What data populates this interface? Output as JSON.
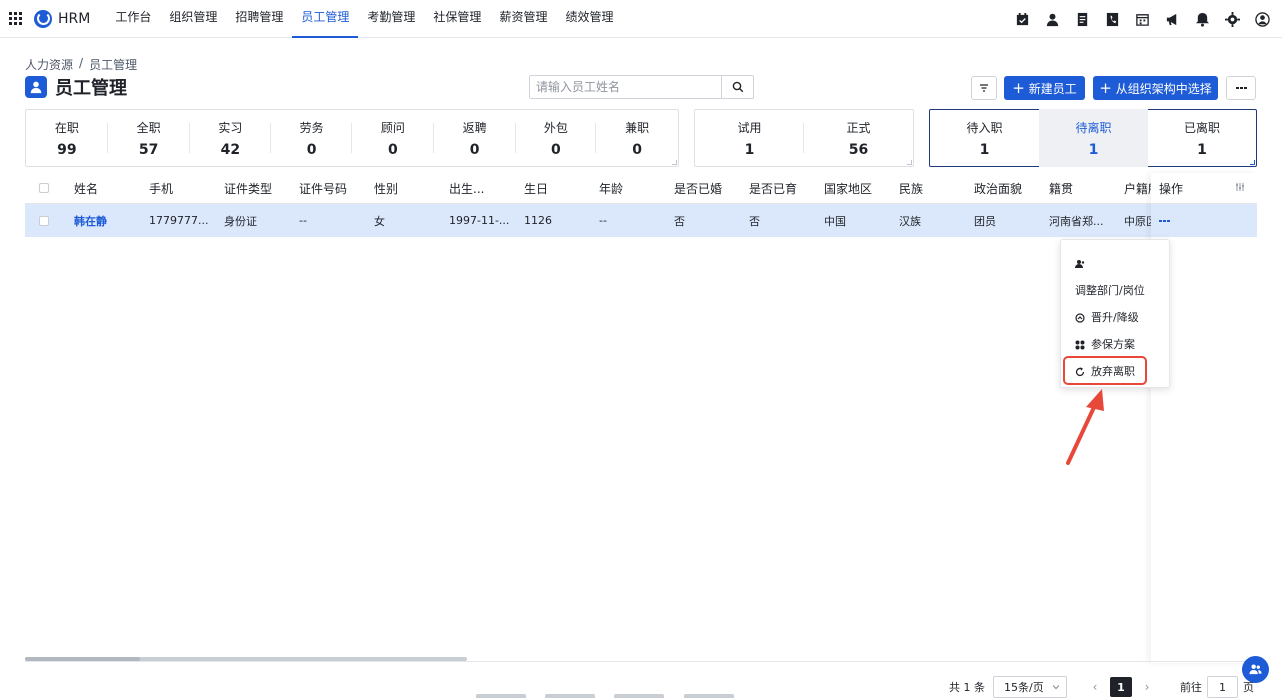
{
  "app": {
    "name": "HRM"
  },
  "nav": {
    "items": [
      "工作台",
      "组织管理",
      "招聘管理",
      "员工管理",
      "考勤管理",
      "社保管理",
      "薪资管理",
      "绩效管理"
    ],
    "active_index": 3
  },
  "breadcrumb": {
    "root": "人力资源",
    "sep": "/",
    "current": "员工管理"
  },
  "page": {
    "title": "员工管理"
  },
  "search": {
    "placeholder": "请输入员工姓名",
    "value": ""
  },
  "actions": {
    "new_employee": "新建员工",
    "from_org": "从组织架构中选择"
  },
  "stats_group1": [
    {
      "label": "在职",
      "value": "99"
    },
    {
      "label": "全职",
      "value": "57"
    },
    {
      "label": "实习",
      "value": "42"
    },
    {
      "label": "劳务",
      "value": "0"
    },
    {
      "label": "顾问",
      "value": "0"
    },
    {
      "label": "返聘",
      "value": "0"
    },
    {
      "label": "外包",
      "value": "0"
    },
    {
      "label": "兼职",
      "value": "0"
    }
  ],
  "stats_group2": [
    {
      "label": "试用",
      "value": "1"
    },
    {
      "label": "正式",
      "value": "56"
    }
  ],
  "stats_group3": [
    {
      "label": "待入职",
      "value": "1"
    },
    {
      "label": "待离职",
      "value": "1"
    },
    {
      "label": "已离职",
      "value": "1"
    }
  ],
  "table": {
    "columns": [
      "姓名",
      "手机",
      "证件类型",
      "证件号码",
      "性别",
      "出生...",
      "生日",
      "年龄",
      "是否已婚",
      "是否已育",
      "国家地区",
      "民族",
      "政治面貌",
      "籍贯",
      "户籍所"
    ],
    "ops_header": "操作",
    "rows": [
      [
        "韩在静",
        "1779777...",
        "身份证",
        "--",
        "女",
        "1997-11-...",
        "1126",
        "--",
        "否",
        "否",
        "中国",
        "汉族",
        "团员",
        "河南省郑...",
        "中原区"
      ]
    ]
  },
  "row_menu": {
    "items": [
      "调整部门/岗位",
      "晋升/降级",
      "参保方案",
      "放弃离职"
    ],
    "highlighted": "放弃离职"
  },
  "pagination": {
    "total": "共 1 条",
    "page_size": "15条/页",
    "current": "1",
    "goto_label": "前往",
    "goto_value": "1",
    "page_suffix": "页"
  },
  "colors": {
    "primary": "#1e5bd6",
    "row_selected": "#dbe7fb",
    "annotation": "#e8483a"
  }
}
